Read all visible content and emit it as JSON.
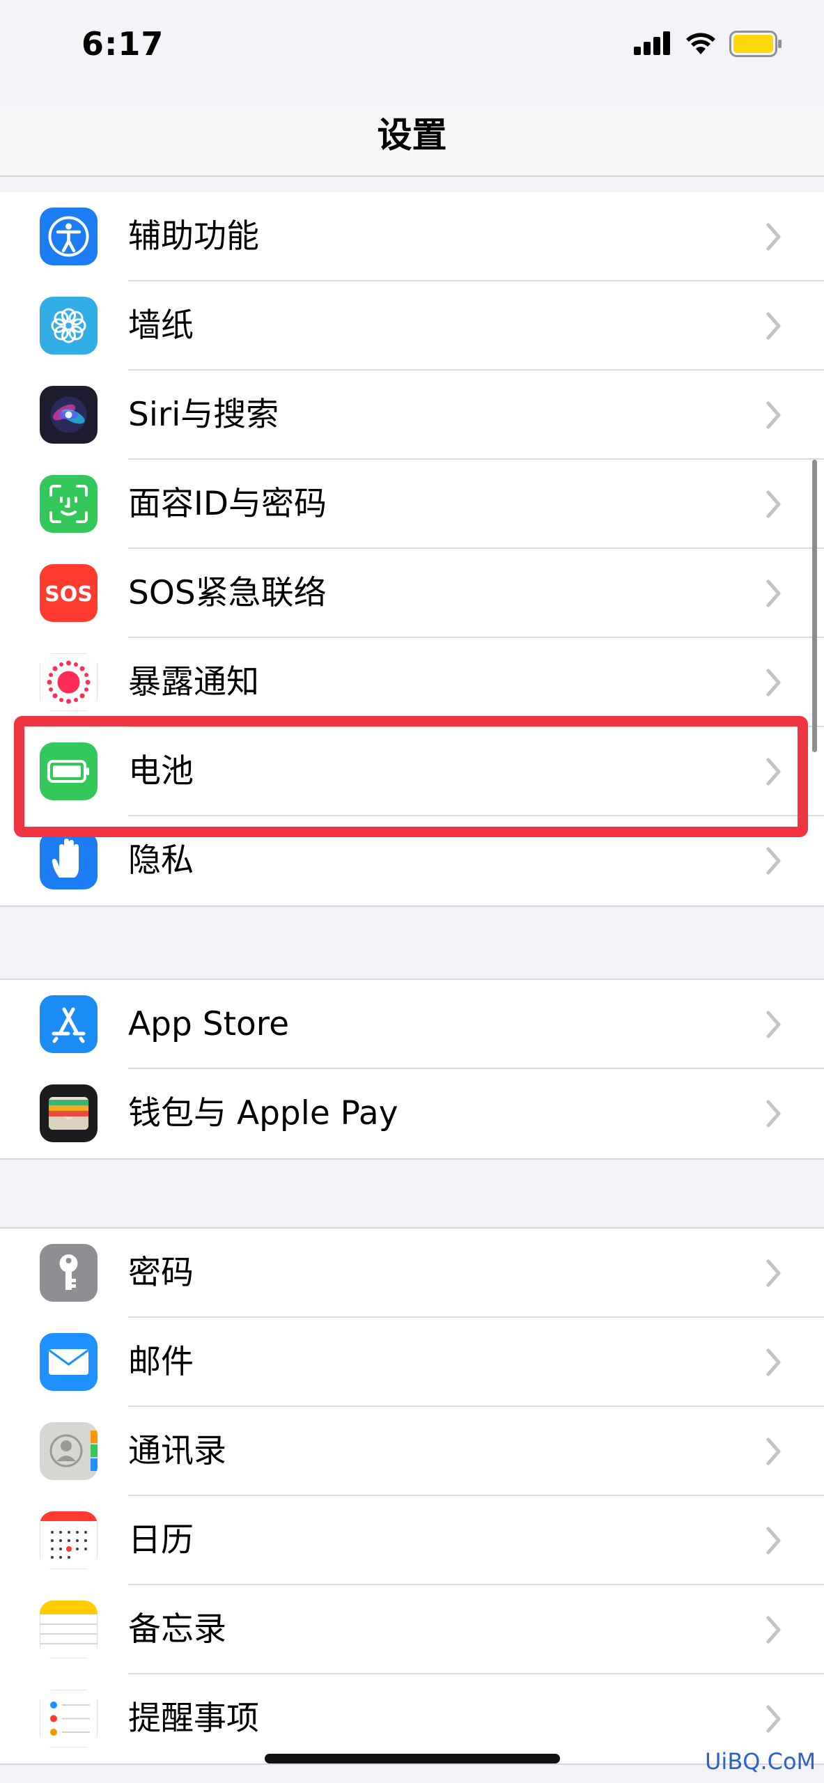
{
  "status_bar": {
    "time": "6:17"
  },
  "nav": {
    "title": "设置"
  },
  "groups": [
    {
      "items": [
        {
          "label": "辅助功能"
        },
        {
          "label": "墙纸"
        },
        {
          "label": "Siri与搜索"
        },
        {
          "label": "面容ID与密码"
        },
        {
          "label": "SOS紧急联络"
        },
        {
          "label": "暴露通知"
        },
        {
          "label": "电池"
        },
        {
          "label": "隐私"
        }
      ]
    },
    {
      "items": [
        {
          "label": "App Store"
        },
        {
          "label": "钱包与 Apple Pay"
        }
      ]
    },
    {
      "items": [
        {
          "label": "密码"
        },
        {
          "label": "邮件"
        },
        {
          "label": "通讯录"
        },
        {
          "label": "日历"
        },
        {
          "label": "备忘录"
        },
        {
          "label": "提醒事项"
        }
      ]
    }
  ],
  "sos_icon_text": "SOS",
  "watermark": "UiBQ.CoM",
  "colors": {
    "highlight": "#f03541",
    "battery_fill": "#ffd60a"
  }
}
